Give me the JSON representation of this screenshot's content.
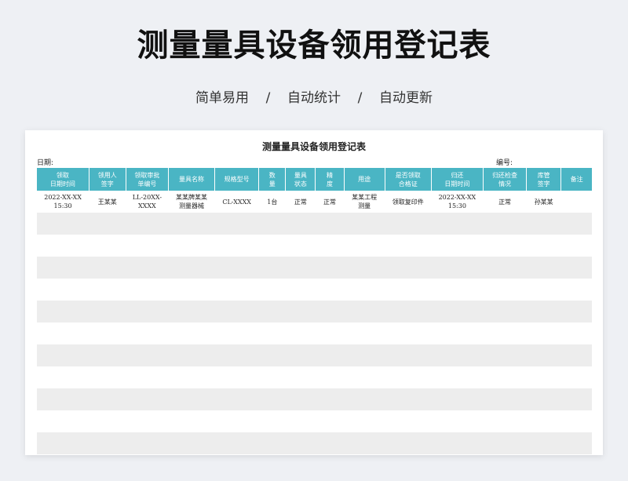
{
  "header": {
    "title": "测量量具设备领用登记表",
    "subtitle": "简单易用    /    自动统计    /    自动更新"
  },
  "sheet": {
    "title": "测量量具设备领用登记表",
    "date_label": "日期:",
    "number_label": "编号:"
  },
  "table": {
    "columns": [
      "领取\n日期时间",
      "领用人\n签字",
      "领取审批\n单编号",
      "量具名称",
      "规格型号",
      "数\n量",
      "量具\n状态",
      "精\n度",
      "用途",
      "是否领取\n合格证",
      "归还\n日期时间",
      "归还检查\n情况",
      "库管\n签字",
      "备注"
    ],
    "rows": [
      [
        "2022-XX-XX\n15:30",
        "王某某",
        "LL-20XX-\nXXXX",
        "某某牌某某\n测量器械",
        "CL-XXXX",
        "1台",
        "正常",
        "正常",
        "某某工程\n测量",
        "领取复印件",
        "2022-XX-XX\n15:30",
        "正常",
        "孙某某",
        ""
      ]
    ],
    "empty_rows": 11
  }
}
